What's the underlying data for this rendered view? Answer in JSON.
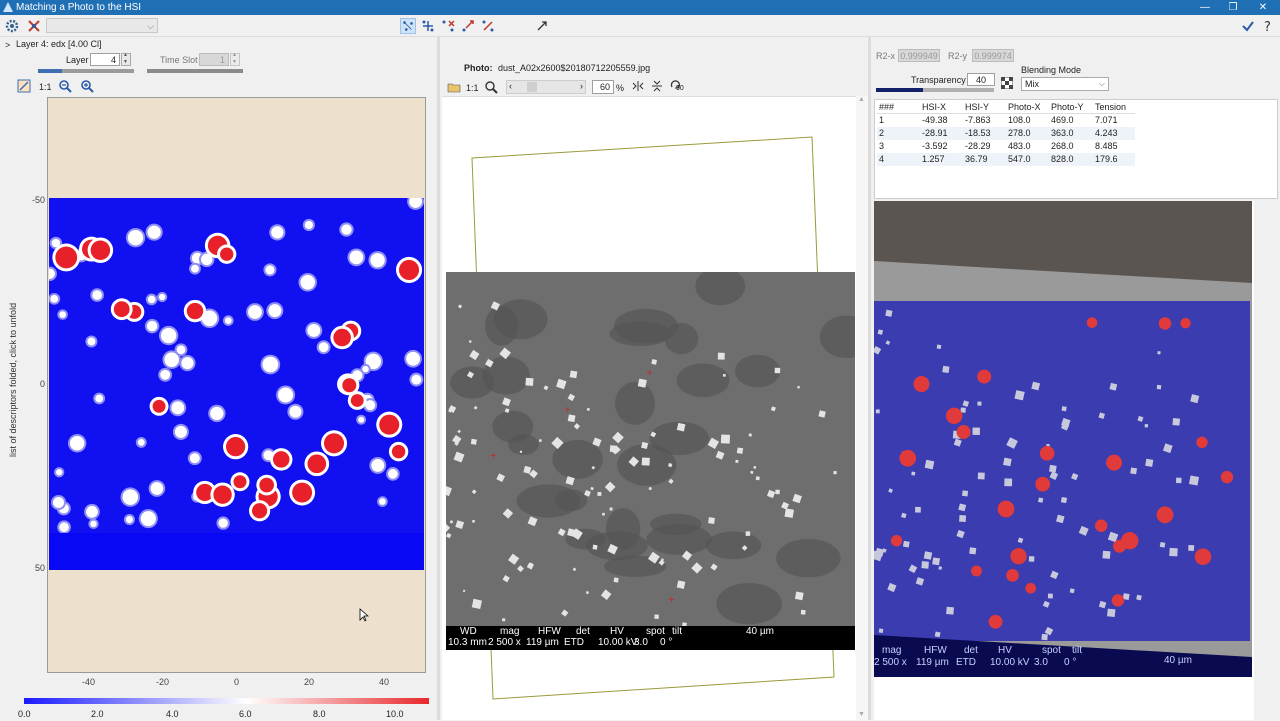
{
  "window": {
    "title": "Matching a Photo to the HSI"
  },
  "toolbar": {
    "layer_dropdown_value": ""
  },
  "left": {
    "layer_title": "Layer 4: edx [4.00 Cl]",
    "layer_label": "Layer",
    "layer_value": "4",
    "timeslot_label": "Time Slot",
    "timeslot_value": "1",
    "zoom_label": "1:1",
    "side_note": "list of descriptors folded, click to unfold",
    "y_ticks": [
      "-50",
      "0",
      "50"
    ],
    "x_ticks": [
      "-40",
      "-20",
      "0",
      "20",
      "40"
    ],
    "colorbar_ticks": [
      "0.0",
      "2.0",
      "4.0",
      "6.0",
      "8.0",
      "10.0"
    ],
    "colorbar_low": "#1a1aff",
    "colorbar_mid": "#ffffff",
    "colorbar_high": "#e8282c"
  },
  "middle": {
    "photo_label": "Photo:",
    "photo_file": "dust_A02x2600$20180712205559.jpg",
    "zoom_label": "1:1",
    "zoom_percent": "60",
    "percent_sign": "%",
    "rotate_label": "90",
    "sem_bar": {
      "headers": [
        "WD",
        "mag",
        "HFW",
        "det",
        "HV",
        "spot",
        "tilt"
      ],
      "values": [
        "10.3 mm",
        "2 500 x",
        "119 µm",
        "ETD",
        "10.00 kV",
        "3.0",
        "0 °"
      ],
      "scale": "40 µm"
    }
  },
  "right": {
    "r2x_label": "R2-x",
    "r2x_value": "0.999949",
    "r2y_label": "R2-y",
    "r2y_value": "0.999974",
    "transparency_label": "Transparency",
    "transparency_value": "40",
    "blending_label": "Blending Mode",
    "blending_value": "Mix",
    "table": {
      "headers": [
        "###",
        "HSI-X",
        "HSI-Y",
        "Photo-X",
        "Photo-Y",
        "Tension"
      ],
      "rows": [
        [
          "1",
          "-49.38",
          "-7.863",
          "108.0",
          "469.0",
          "7.071"
        ],
        [
          "2",
          "-28.91",
          "-18.53",
          "278.0",
          "363.0",
          "4.243"
        ],
        [
          "3",
          "-3.592",
          "-28.29",
          "483.0",
          "268.0",
          "8.485"
        ],
        [
          "4",
          "1.257",
          "36.79",
          "547.0",
          "828.0",
          "179.6"
        ]
      ]
    },
    "overlay_bar": {
      "headers": [
        "mag",
        "HFW",
        "det",
        "HV",
        "spot",
        "tilt"
      ],
      "values": [
        "2 500 x",
        "119 µm",
        "ETD",
        "10.00 kV",
        "3.0",
        "0 °"
      ],
      "scale": "40 µm"
    }
  }
}
